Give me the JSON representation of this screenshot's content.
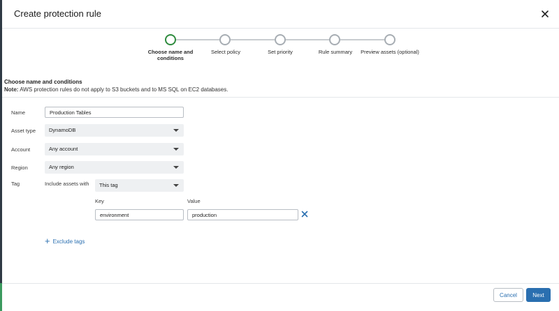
{
  "dialog": {
    "title": "Create protection rule",
    "close_icon": "close-icon"
  },
  "stepper": {
    "steps": [
      {
        "label": "Choose name and conditions",
        "active": true
      },
      {
        "label": "Select policy",
        "active": false
      },
      {
        "label": "Set priority",
        "active": false
      },
      {
        "label": "Rule summary",
        "active": false
      },
      {
        "label": "Preview assets (optional)",
        "active": false
      }
    ]
  },
  "section": {
    "title": "Choose name and conditions",
    "note_label": "Note:",
    "note_text": " AWS protection rules do not apply to S3 buckets and to MS SQL on EC2 databases."
  },
  "form": {
    "name": {
      "label": "Name",
      "value": "Production Tables"
    },
    "asset_type": {
      "label": "Asset type",
      "value": "DynamoDB"
    },
    "account": {
      "label": "Account",
      "value": "Any account"
    },
    "region": {
      "label": "Region",
      "value": "Any region"
    },
    "tag": {
      "label": "Tag",
      "include_label": "Include assets with",
      "mode": "This tag",
      "key_header": "Key",
      "value_header": "Value",
      "key": "environment",
      "value": "production"
    },
    "exclude_tags_label": "Exclude tags"
  },
  "footer": {
    "cancel_label": "Cancel",
    "next_label": "Next"
  },
  "colors": {
    "accent": "#2a6fb0",
    "active_step": "#2e8b3e"
  }
}
